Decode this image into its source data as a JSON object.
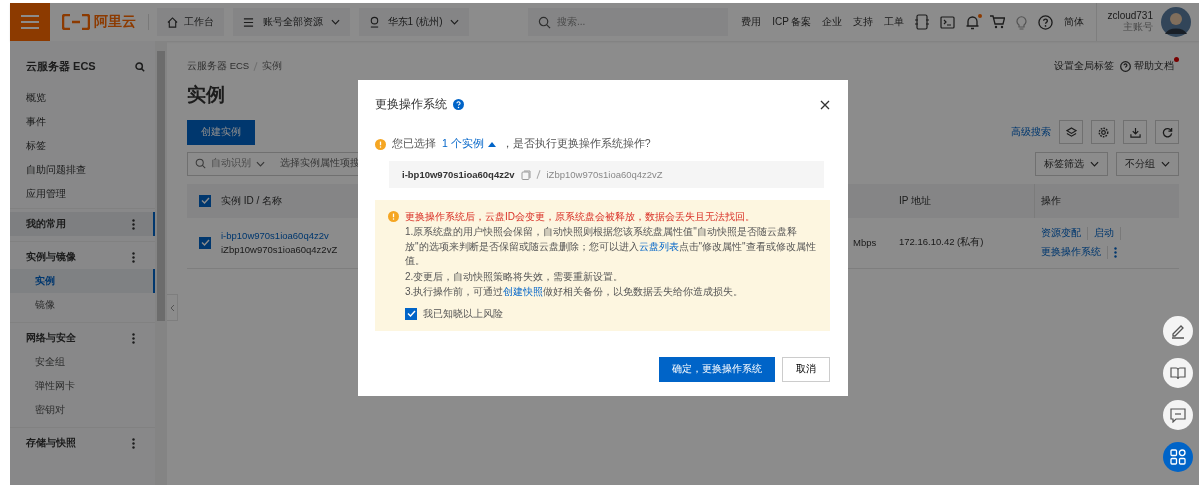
{
  "topbar": {
    "logo": "阿里云",
    "workbench": "工作台",
    "resource_scope": "账号全部资源",
    "region": "华东1 (杭州)",
    "search": {
      "placeholder": "搜索..."
    },
    "links": [
      "费用",
      "ICP 备案",
      "企业",
      "支持",
      "工单"
    ],
    "notification_unread": true,
    "language": "简体",
    "user": {
      "name": "zcloud731",
      "role": "主账号"
    }
  },
  "sidebar": {
    "title": "云服务器 ECS",
    "items": [
      {
        "label": "概览",
        "selected": false
      },
      {
        "label": "事件",
        "selected": false
      },
      {
        "label": "标签",
        "selected": false
      },
      {
        "label": "自助问题排查",
        "selected": false
      },
      {
        "label": "应用管理",
        "selected": false
      }
    ],
    "groups": [
      {
        "title": "我的常用",
        "selected": true
      },
      {
        "title": "实例与镜像",
        "selected": false,
        "children": [
          {
            "label": "实例",
            "selected": true
          },
          {
            "label": "镜像",
            "selected": false
          }
        ]
      },
      {
        "title": "网络与安全",
        "selected": false,
        "children": [
          {
            "label": "安全组",
            "selected": false
          },
          {
            "label": "弹性网卡",
            "selected": false
          },
          {
            "label": "密钥对",
            "selected": false
          }
        ]
      },
      {
        "title": "存储与快照",
        "selected": false
      }
    ]
  },
  "page": {
    "breadcrumb": [
      "云服务器 ECS",
      "实例"
    ],
    "header_links": [
      {
        "label": "设置全局标签",
        "kind": "text"
      },
      {
        "label": "帮助文档",
        "kind": "help",
        "unread": true
      }
    ],
    "title": "实例",
    "create_button": "创建实例",
    "advanced_search": "高级搜索",
    "search_mode": "自动识别",
    "search_placeholder": "选择实例属性项搜",
    "tag_filter": "标签筛选",
    "grouping": "不分组",
    "table": {
      "header_checked": true,
      "columns": [
        "实例 ID / 名称",
        "IP 地址",
        "操作"
      ],
      "rows": [
        {
          "checked": true,
          "id": "i-bp10w970s1ioa60q4z2v",
          "name": "iZbp10w970s1ioa60q4z2vZ",
          "bandwidth": "Mbps",
          "ip": "172.16.10.42 (私有)",
          "actions": [
            "资源变配",
            "启动",
            "更换操作系统"
          ]
        }
      ]
    }
  },
  "dialog": {
    "title": "更换操作系统",
    "prompt": {
      "prefix": "您已选择",
      "link": "1 个实例",
      "suffix": "，是否执行更换操作系统操作?"
    },
    "instance": {
      "id": "i-bp10w970s1ioa60q4z2v",
      "name": "iZbp10w970s1ioa60q4z2vZ"
    },
    "warning": {
      "headline": "更换操作系统后，云盘ID会变更，原系统盘会被释放，数据会丢失且无法找回。",
      "lines": [
        [
          {
            "kind": "text",
            "text": "1.原系统盘的用户快照会保留，自动快照则根据您该系统盘属性值\"自动快照是否随云盘释放\"的选项来判断是否保留或随云盘删除；您可以进入"
          },
          {
            "kind": "link",
            "text": "云盘列表"
          },
          {
            "kind": "text",
            "text": "点击\"修改属性\"查看或修改属性值。"
          }
        ],
        [
          {
            "kind": "text",
            "text": "2.变更后，自动快照策略将失效，需要重新设置。"
          }
        ],
        [
          {
            "kind": "text",
            "text": "3.执行操作前，可通过"
          },
          {
            "kind": "link",
            "text": "创建快照"
          },
          {
            "kind": "text",
            "text": "做好相关备份，以免数据丢失给你造成损失。"
          }
        ]
      ]
    },
    "acknowledge": {
      "label": "我已知晓以上风险",
      "checked": true
    },
    "confirm": "确定，更换操作系统",
    "cancel": "取消"
  }
}
